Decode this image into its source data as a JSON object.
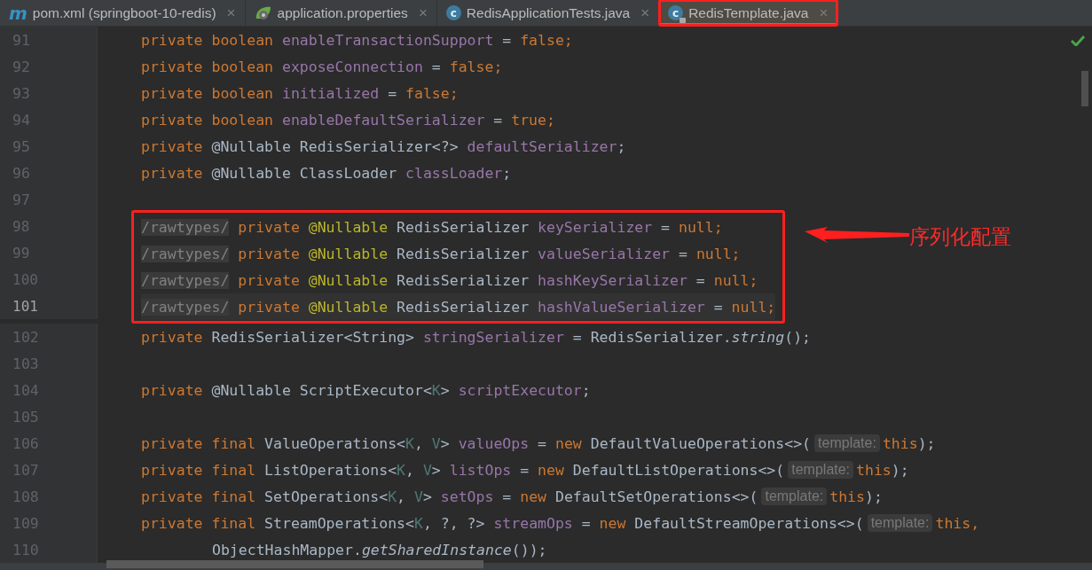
{
  "tabs": [
    {
      "kind": "maven",
      "icon_text": "m",
      "label": "pom.xml (springboot-10-redis)",
      "selected": false,
      "boxed": false
    },
    {
      "kind": "spring",
      "label": "application.properties",
      "selected": false,
      "boxed": false
    },
    {
      "kind": "class",
      "icon_text": "c",
      "label": "RedisApplicationTests.java",
      "selected": false,
      "locked": false,
      "boxed": false
    },
    {
      "kind": "class",
      "icon_text": "c",
      "label": "RedisTemplate.java",
      "selected": true,
      "locked": true,
      "boxed": true
    }
  ],
  "close_glyph": "×",
  "callout": {
    "label": "序列化配置"
  },
  "lines": [
    {
      "number": "91",
      "current": false,
      "boxed": false,
      "continuation": false,
      "tokens": [
        {
          "kind": "kw",
          "text": "private boolean "
        },
        {
          "kind": "field",
          "text": "enableTransactionSupport"
        },
        {
          "kind": "plain",
          "text": " = "
        },
        {
          "kind": "kw",
          "text": "false;"
        }
      ]
    },
    {
      "number": "92",
      "current": false,
      "boxed": false,
      "continuation": false,
      "tokens": [
        {
          "kind": "kw",
          "text": "private boolean "
        },
        {
          "kind": "field",
          "text": "exposeConnection"
        },
        {
          "kind": "plain",
          "text": " = "
        },
        {
          "kind": "kw",
          "text": "false;"
        }
      ]
    },
    {
      "number": "93",
      "current": false,
      "boxed": false,
      "continuation": false,
      "tokens": [
        {
          "kind": "kw",
          "text": "private boolean "
        },
        {
          "kind": "field",
          "text": "initialized"
        },
        {
          "kind": "plain",
          "text": " = "
        },
        {
          "kind": "kw",
          "text": "false;"
        }
      ]
    },
    {
      "number": "94",
      "current": false,
      "boxed": false,
      "continuation": false,
      "tokens": [
        {
          "kind": "kw",
          "text": "private boolean "
        },
        {
          "kind": "field",
          "text": "enableDefaultSerializer"
        },
        {
          "kind": "plain",
          "text": " = "
        },
        {
          "kind": "kw",
          "text": "true;"
        }
      ]
    },
    {
      "number": "95",
      "current": false,
      "boxed": false,
      "continuation": false,
      "tokens": [
        {
          "kind": "kw",
          "text": "private "
        },
        {
          "kind": "plain",
          "text": "@Nullable RedisSerializer<?> "
        },
        {
          "kind": "field",
          "text": "defaultSerializer"
        },
        {
          "kind": "plain",
          "text": ";"
        }
      ]
    },
    {
      "number": "96",
      "current": false,
      "boxed": false,
      "continuation": false,
      "tokens": [
        {
          "kind": "kw",
          "text": "private "
        },
        {
          "kind": "plain",
          "text": "@Nullable ClassLoader "
        },
        {
          "kind": "field",
          "text": "classLoader"
        },
        {
          "kind": "plain",
          "text": ";"
        }
      ]
    },
    {
      "number": "97",
      "current": false,
      "boxed": false
    },
    {
      "number": "98",
      "current": false,
      "boxed": true,
      "continuation": false,
      "tokens": [
        {
          "kind": "folded",
          "text": "/rawtypes/"
        },
        {
          "kind": "kw",
          "text": " private "
        },
        {
          "kind": "annotation",
          "text": "@Nullable "
        },
        {
          "kind": "plain",
          "text": "RedisSerializer "
        },
        {
          "kind": "field",
          "text": "keySerializer"
        },
        {
          "kind": "plain",
          "text": " = "
        },
        {
          "kind": "kw",
          "text": "null;"
        }
      ]
    },
    {
      "number": "99",
      "current": false,
      "boxed": true,
      "continuation": false,
      "tokens": [
        {
          "kind": "folded",
          "text": "/rawtypes/"
        },
        {
          "kind": "kw",
          "text": " private "
        },
        {
          "kind": "annotation",
          "text": "@Nullable "
        },
        {
          "kind": "plain",
          "text": "RedisSerializer "
        },
        {
          "kind": "field",
          "text": "valueSerializer"
        },
        {
          "kind": "plain",
          "text": " = "
        },
        {
          "kind": "kw",
          "text": "null;"
        }
      ]
    },
    {
      "number": "100",
      "current": false,
      "boxed": true,
      "continuation": false,
      "tokens": [
        {
          "kind": "folded",
          "text": "/rawtypes/"
        },
        {
          "kind": "kw",
          "text": " private "
        },
        {
          "kind": "annotation",
          "text": "@Nullable "
        },
        {
          "kind": "plain",
          "text": "RedisSerializer "
        },
        {
          "kind": "field",
          "text": "hashKeySerializer"
        },
        {
          "kind": "plain",
          "text": " = "
        },
        {
          "kind": "kw",
          "text": "null;"
        }
      ]
    },
    {
      "number": "101",
      "current": true,
      "boxed": true,
      "continuation": false,
      "tokens": [
        {
          "kind": "folded",
          "text": "/rawtypes/"
        },
        {
          "kind": "kw",
          "text": " private "
        },
        {
          "kind": "annotation",
          "text": "@Nullable "
        },
        {
          "kind": "plain",
          "text": "RedisSerializer "
        },
        {
          "kind": "field",
          "text": "hashValueSerializer"
        },
        {
          "kind": "plain",
          "text": " = "
        },
        {
          "kind": "kw",
          "text": "null;"
        }
      ]
    },
    {
      "number": "102",
      "current": false,
      "boxed": false,
      "continuation": false,
      "tokens": [
        {
          "kind": "kw",
          "text": "private "
        },
        {
          "kind": "plain",
          "text": "RedisSerializer<String> "
        },
        {
          "kind": "field",
          "text": "stringSerializer"
        },
        {
          "kind": "plain",
          "text": " = RedisSerializer."
        },
        {
          "kind": "italic",
          "text": "string"
        },
        {
          "kind": "plain",
          "text": "();"
        }
      ]
    },
    {
      "number": "103",
      "current": false,
      "boxed": false
    },
    {
      "number": "104",
      "current": false,
      "boxed": false,
      "continuation": false,
      "tokens": [
        {
          "kind": "kw",
          "text": "private "
        },
        {
          "kind": "plain",
          "text": "@Nullable ScriptExecutor<"
        },
        {
          "kind": "typeparam",
          "text": "K"
        },
        {
          "kind": "plain",
          "text": "> "
        },
        {
          "kind": "field",
          "text": "scriptExecutor"
        },
        {
          "kind": "plain",
          "text": ";"
        }
      ]
    },
    {
      "number": "105",
      "current": false,
      "boxed": false
    },
    {
      "number": "106",
      "current": false,
      "boxed": false,
      "continuation": false,
      "tokens": [
        {
          "kind": "kw",
          "text": "private final "
        },
        {
          "kind": "plain",
          "text": "ValueOperations<"
        },
        {
          "kind": "typeparam",
          "text": "K"
        },
        {
          "kind": "plain",
          "text": ", "
        },
        {
          "kind": "typeparam",
          "text": "V"
        },
        {
          "kind": "plain",
          "text": "> "
        },
        {
          "kind": "field",
          "text": "valueOps"
        },
        {
          "kind": "plain",
          "text": " = "
        },
        {
          "kind": "kw",
          "text": "new "
        },
        {
          "kind": "plain",
          "text": "DefaultValueOperations<>("
        },
        {
          "kind": "hint",
          "text": "template:"
        },
        {
          "kind": "kw",
          "text": "this"
        },
        {
          "kind": "plain",
          "text": ");"
        }
      ]
    },
    {
      "number": "107",
      "current": false,
      "boxed": false,
      "continuation": false,
      "tokens": [
        {
          "kind": "kw",
          "text": "private final "
        },
        {
          "kind": "plain",
          "text": "ListOperations<"
        },
        {
          "kind": "typeparam",
          "text": "K"
        },
        {
          "kind": "plain",
          "text": ", "
        },
        {
          "kind": "typeparam",
          "text": "V"
        },
        {
          "kind": "plain",
          "text": "> "
        },
        {
          "kind": "field",
          "text": "listOps"
        },
        {
          "kind": "plain",
          "text": " = "
        },
        {
          "kind": "kw",
          "text": "new "
        },
        {
          "kind": "plain",
          "text": "DefaultListOperations<>("
        },
        {
          "kind": "hint",
          "text": "template:"
        },
        {
          "kind": "kw",
          "text": "this"
        },
        {
          "kind": "plain",
          "text": ");"
        }
      ]
    },
    {
      "number": "108",
      "current": false,
      "boxed": false,
      "continuation": false,
      "tokens": [
        {
          "kind": "kw",
          "text": "private final "
        },
        {
          "kind": "plain",
          "text": "SetOperations<"
        },
        {
          "kind": "typeparam",
          "text": "K"
        },
        {
          "kind": "plain",
          "text": ", "
        },
        {
          "kind": "typeparam",
          "text": "V"
        },
        {
          "kind": "plain",
          "text": "> "
        },
        {
          "kind": "field",
          "text": "setOps"
        },
        {
          "kind": "plain",
          "text": " = "
        },
        {
          "kind": "kw",
          "text": "new "
        },
        {
          "kind": "plain",
          "text": "DefaultSetOperations<>("
        },
        {
          "kind": "hint",
          "text": "template:"
        },
        {
          "kind": "kw",
          "text": "this"
        },
        {
          "kind": "plain",
          "text": ");"
        }
      ]
    },
    {
      "number": "109",
      "current": false,
      "boxed": false,
      "continuation": false,
      "tokens": [
        {
          "kind": "kw",
          "text": "private final "
        },
        {
          "kind": "plain",
          "text": "StreamOperations<"
        },
        {
          "kind": "typeparam",
          "text": "K"
        },
        {
          "kind": "plain",
          "text": ", ?, ?> "
        },
        {
          "kind": "field",
          "text": "streamOps"
        },
        {
          "kind": "plain",
          "text": " = "
        },
        {
          "kind": "kw",
          "text": "new "
        },
        {
          "kind": "plain",
          "text": "DefaultStreamOperations<>("
        },
        {
          "kind": "hint",
          "text": "template:"
        },
        {
          "kind": "kw",
          "text": "this,"
        }
      ]
    },
    {
      "number": "110",
      "current": false,
      "boxed": false,
      "continuation": true,
      "tokens": [
        {
          "kind": "plain",
          "text": "ObjectHashMapper."
        },
        {
          "kind": "italic",
          "text": "getSharedInstance"
        },
        {
          "kind": "plain",
          "text": "());"
        }
      ]
    }
  ]
}
